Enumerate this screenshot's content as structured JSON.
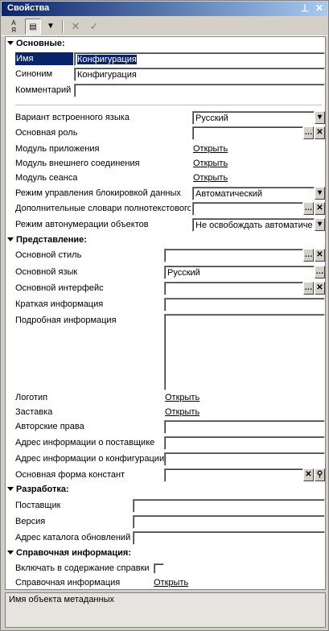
{
  "title": "Свойства",
  "toolbar": {
    "sort_az": "АЯ",
    "group": "▤",
    "filter": "▼",
    "cancel": "✕",
    "ok": "✓"
  },
  "sections": {
    "main": "Основные:",
    "view": "Представление:",
    "dev": "Разработка:",
    "help": "Справочная информация:"
  },
  "main": {
    "name_label": "Имя",
    "name_value": "Конфигурация",
    "synonym_label": "Синоним",
    "synonym_value": "Конфигурация",
    "comment_label": "Комментарий",
    "comment_value": "",
    "lang_variant_label": "Вариант встроенного языка",
    "lang_variant_value": "Русский",
    "main_role_label": "Основная роль",
    "main_role_value": "",
    "app_module_label": "Модуль приложения",
    "app_module_link": "Открыть",
    "ext_conn_label": "Модуль внешнего соединения",
    "ext_conn_link": "Открыть",
    "session_label": "Модуль сеанса",
    "session_link": "Открыть",
    "lock_mode_label": "Режим управления блокировкой данных",
    "lock_mode_value": "Автоматический",
    "fulltext_label": "Дополнительные словари полнотекстового",
    "fulltext_value": "",
    "autonum_label": "Режим автонумерации объектов",
    "autonum_value": "Не освобождать автоматиче"
  },
  "view": {
    "style_label": "Основной стиль",
    "style_value": "",
    "lang_label": "Основной язык",
    "lang_value": "Русский",
    "iface_label": "Основной интерфейс",
    "iface_value": "",
    "brief_label": "Краткая информация",
    "brief_value": "",
    "detail_label": "Подробная информация",
    "detail_value": "",
    "logo_label": "Логотип",
    "logo_link": "Открыть",
    "splash_label": "Заставка",
    "splash_link": "Открыть",
    "copyright_label": "Авторские права",
    "copyright_value": "",
    "vendor_info_label": "Адрес информации о поставщике",
    "vendor_info_value": "",
    "config_info_label": "Адрес информации о конфигурации",
    "config_info_value": "",
    "const_form_label": "Основная форма констант",
    "const_form_value": ""
  },
  "dev": {
    "vendor_label": "Поставщик",
    "vendor_value": "",
    "version_label": "Версия",
    "version_value": "",
    "update_label": "Адрес каталога обновлений",
    "update_value": ""
  },
  "help": {
    "include_label": "Включать в содержание справки",
    "include_checked": false,
    "info_label": "Справочная информация",
    "info_link": "Открыть"
  },
  "description": "Имя объекта метаданных"
}
